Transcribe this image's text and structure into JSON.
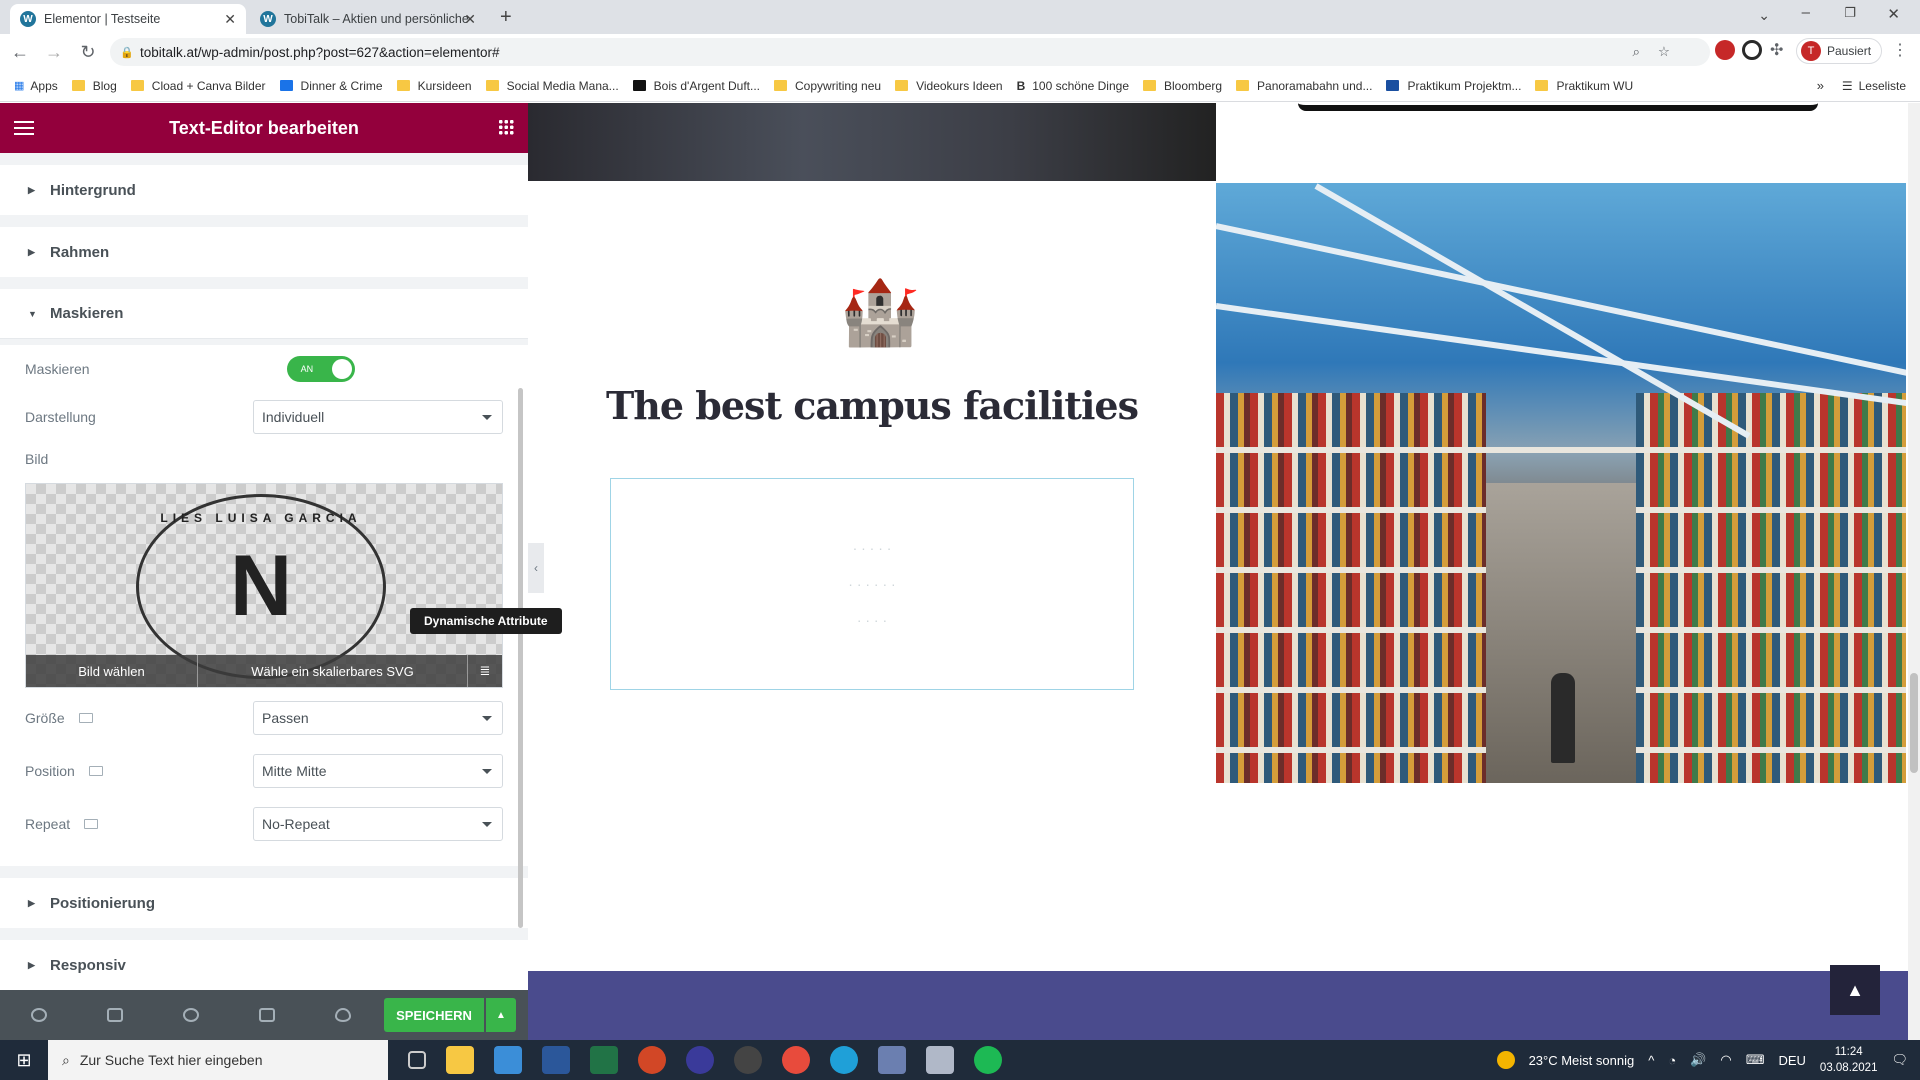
{
  "browser": {
    "tabs": [
      {
        "title": "Elementor | Testseite"
      },
      {
        "title": "TobiTalk – Aktien und persönliche"
      }
    ],
    "url": "tobitalk.at/wp-admin/post.php?post=627&action=elementor#",
    "profile_status": "Pausiert",
    "bookmarks": [
      "Apps",
      "Blog",
      "Cload + Canva Bilder",
      "Dinner & Crime",
      "Kursideen",
      "Social Media Mana...",
      "Bois d'Argent Duft...",
      "Copywriting neu",
      "Videokurs Ideen",
      "100 schöne Dinge",
      "Bloomberg",
      "Panoramabahn und...",
      "Praktikum Projektm...",
      "Praktikum WU"
    ],
    "reading_list": "Leseliste"
  },
  "panel": {
    "title": "Text-Editor bearbeiten",
    "sections": {
      "hintergrund": "Hintergrund",
      "rahmen": "Rahmen",
      "maskieren": "Maskieren",
      "positionierung": "Positionierung",
      "responsiv": "Responsiv"
    },
    "mask": {
      "toggle_label": "Maskieren",
      "toggle_state": "AN",
      "darstellung_label": "Darstellung",
      "darstellung_value": "Individuell",
      "bild_label": "Bild",
      "choose_image": "Bild wählen",
      "choose_svg": "Wähle ein skalierbares SVG",
      "seal_text": "LIES LUISA GARCIA",
      "tooltip": "Dynamische Attribute",
      "size_label": "Größe",
      "size_value": "Passen",
      "position_label": "Position",
      "position_value": "Mitte Mitte",
      "repeat_label": "Repeat",
      "repeat_value": "No-Repeat"
    },
    "save_label": "SPEICHERN"
  },
  "preview": {
    "heading": "The best campus facilities"
  },
  "taskbar": {
    "search_placeholder": "Zur Suche Text hier eingeben",
    "weather": "23°C  Meist sonnig",
    "lang": "DEU",
    "time": "11:24",
    "date": "03.08.2021"
  },
  "colors": {
    "elementor_header": "#93003c",
    "save_green": "#39b54a",
    "castle_teal": "#3fb9a6",
    "purple_band": "#4a4b8d"
  }
}
